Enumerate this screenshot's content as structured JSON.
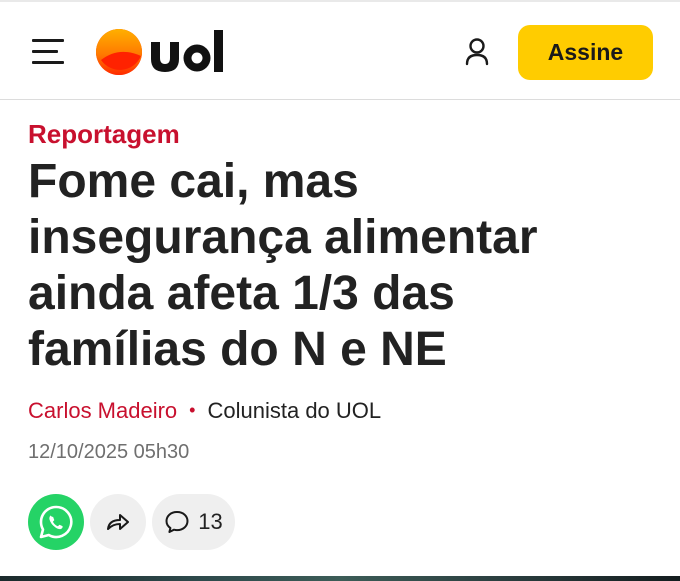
{
  "header": {
    "logo_text": "uol",
    "subscribe_label": "Assine"
  },
  "article": {
    "kicker": "Reportagem",
    "headline_lines": [
      "Fome cai, mas",
      "insegurança alimentar",
      "ainda afeta 1/3 das",
      "famílias do N e NE"
    ],
    "author": "Carlos Madeiro",
    "separator": "•",
    "author_role": "Colunista do UOL",
    "published": "12/10/2025 05h30"
  },
  "share": {
    "comment_count": "13"
  },
  "icons": {
    "menu": "hamburger-menu-icon",
    "user": "user-account-icon",
    "whatsapp": "whatsapp-icon",
    "share": "share-arrow-icon",
    "comment": "comment-bubble-icon"
  },
  "colors": {
    "brand_red": "#c8102e",
    "subscribe_yellow": "#ffcc00",
    "whatsapp_green": "#25d366",
    "logo_orange": "#ff8c00"
  }
}
